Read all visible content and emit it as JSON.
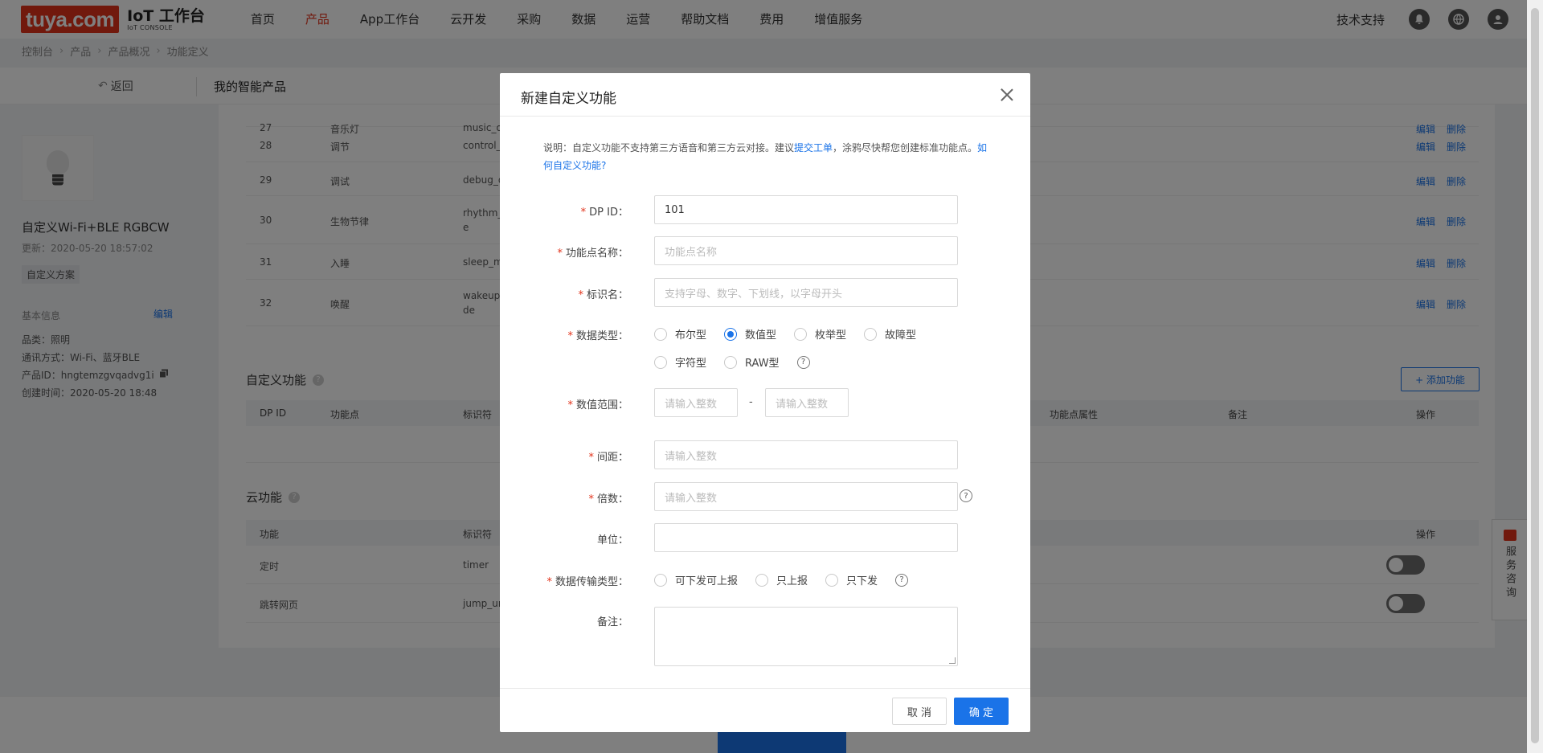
{
  "nav": {
    "logo": "tuya.com",
    "title": "IoT 工作台",
    "subtitle": "IoT CONSOLE",
    "items": [
      "首页",
      "产品",
      "App工作台",
      "云开发",
      "采购",
      "数据",
      "运营",
      "帮助文档",
      "费用",
      "增值服务"
    ],
    "active_index": 1,
    "tech_support": "技术支持"
  },
  "breadcrumb": [
    "控制台",
    "产品",
    "产品概况",
    "功能定义"
  ],
  "subheader": {
    "back": "返回",
    "title": "我的智能产品"
  },
  "product": {
    "name": "自定义Wi-Fi+BLE RGBCW",
    "updated": "更新：2020-05-20 18:57:02",
    "scheme": "自定义方案",
    "basic_label": "基本信息",
    "edit": "编辑",
    "category": "品类：照明",
    "protocol": "通讯方式：Wi-Fi、蓝牙BLE",
    "pid": "产品ID：hngtemzgvqadvg1i",
    "created": "创建时间：2020-05-20 18:48"
  },
  "std_rows": [
    {
      "id": "27",
      "name": "音乐灯",
      "code": "music_d"
    },
    {
      "id": "28",
      "name": "调节",
      "code": "control_"
    },
    {
      "id": "29",
      "name": "调试",
      "code": "debug_d"
    },
    {
      "id": "30",
      "name": "生物节律",
      "code": "rhythm_",
      "code2": "e"
    },
    {
      "id": "31",
      "name": "入睡",
      "code": "sleep_m"
    },
    {
      "id": "32",
      "name": "唤醒",
      "code": "wakeup",
      "code2": "de"
    }
  ],
  "actions": {
    "edit": "编辑",
    "delete": "删除",
    "op": "操作"
  },
  "custom_section": {
    "title": "自定义功能",
    "add_button": "+ 添加功能",
    "headers": [
      "DP ID",
      "功能点",
      "标识符",
      "功能点属性",
      "备注",
      "操作"
    ]
  },
  "cloud_section": {
    "title": "云功能",
    "headers": [
      "功能",
      "标识符",
      "操作"
    ],
    "rows": [
      {
        "name": "定时",
        "code": "timer"
      },
      {
        "name": "跳转网页",
        "code": "jump_ur"
      }
    ]
  },
  "service": "服务咨询",
  "modal": {
    "title": "新建自定义功能",
    "note_prefix": "说明：自定义功能不支持第三方语音和第三方云对接。建议",
    "note_link1": "提交工单",
    "note_middle": "，涂鸦尽快帮您创建标准功能点。",
    "note_link2": "如何自定义功能?",
    "fields": {
      "dp_id": {
        "label": "DP ID：",
        "value": "101"
      },
      "func_name": {
        "label": "功能点名称：",
        "placeholder": "功能点名称"
      },
      "identifier": {
        "label": "标识名：",
        "placeholder": "支持字母、数字、下划线，以字母开头"
      },
      "data_type": {
        "label": "数据类型：",
        "options": [
          "布尔型",
          "数值型",
          "枚举型",
          "故障型",
          "字符型",
          "RAW型"
        ],
        "selected": "数值型"
      },
      "range": {
        "label": "数值范围：",
        "placeholder": "请输入整数",
        "dash": "-"
      },
      "step": {
        "label": "间距：",
        "placeholder": "请输入整数"
      },
      "multiple": {
        "label": "倍数：",
        "placeholder": "请输入整数"
      },
      "unit": {
        "label": "单位：",
        "value": ""
      },
      "transfer": {
        "label": "数据传输类型：",
        "options": [
          "可下发可上报",
          "只上报",
          "只下发"
        ]
      },
      "remark": {
        "label": "备注：",
        "value": ""
      }
    },
    "cancel": "取 消",
    "ok": "确 定"
  },
  "colors": {
    "brand": "#e2321a",
    "primary": "#1a73e8"
  },
  "icons": {
    "bell": "bell-icon",
    "globe": "globe-icon",
    "user": "user-icon",
    "help": "question-icon",
    "copy": "copy-icon",
    "back": "back-arrow-icon"
  }
}
